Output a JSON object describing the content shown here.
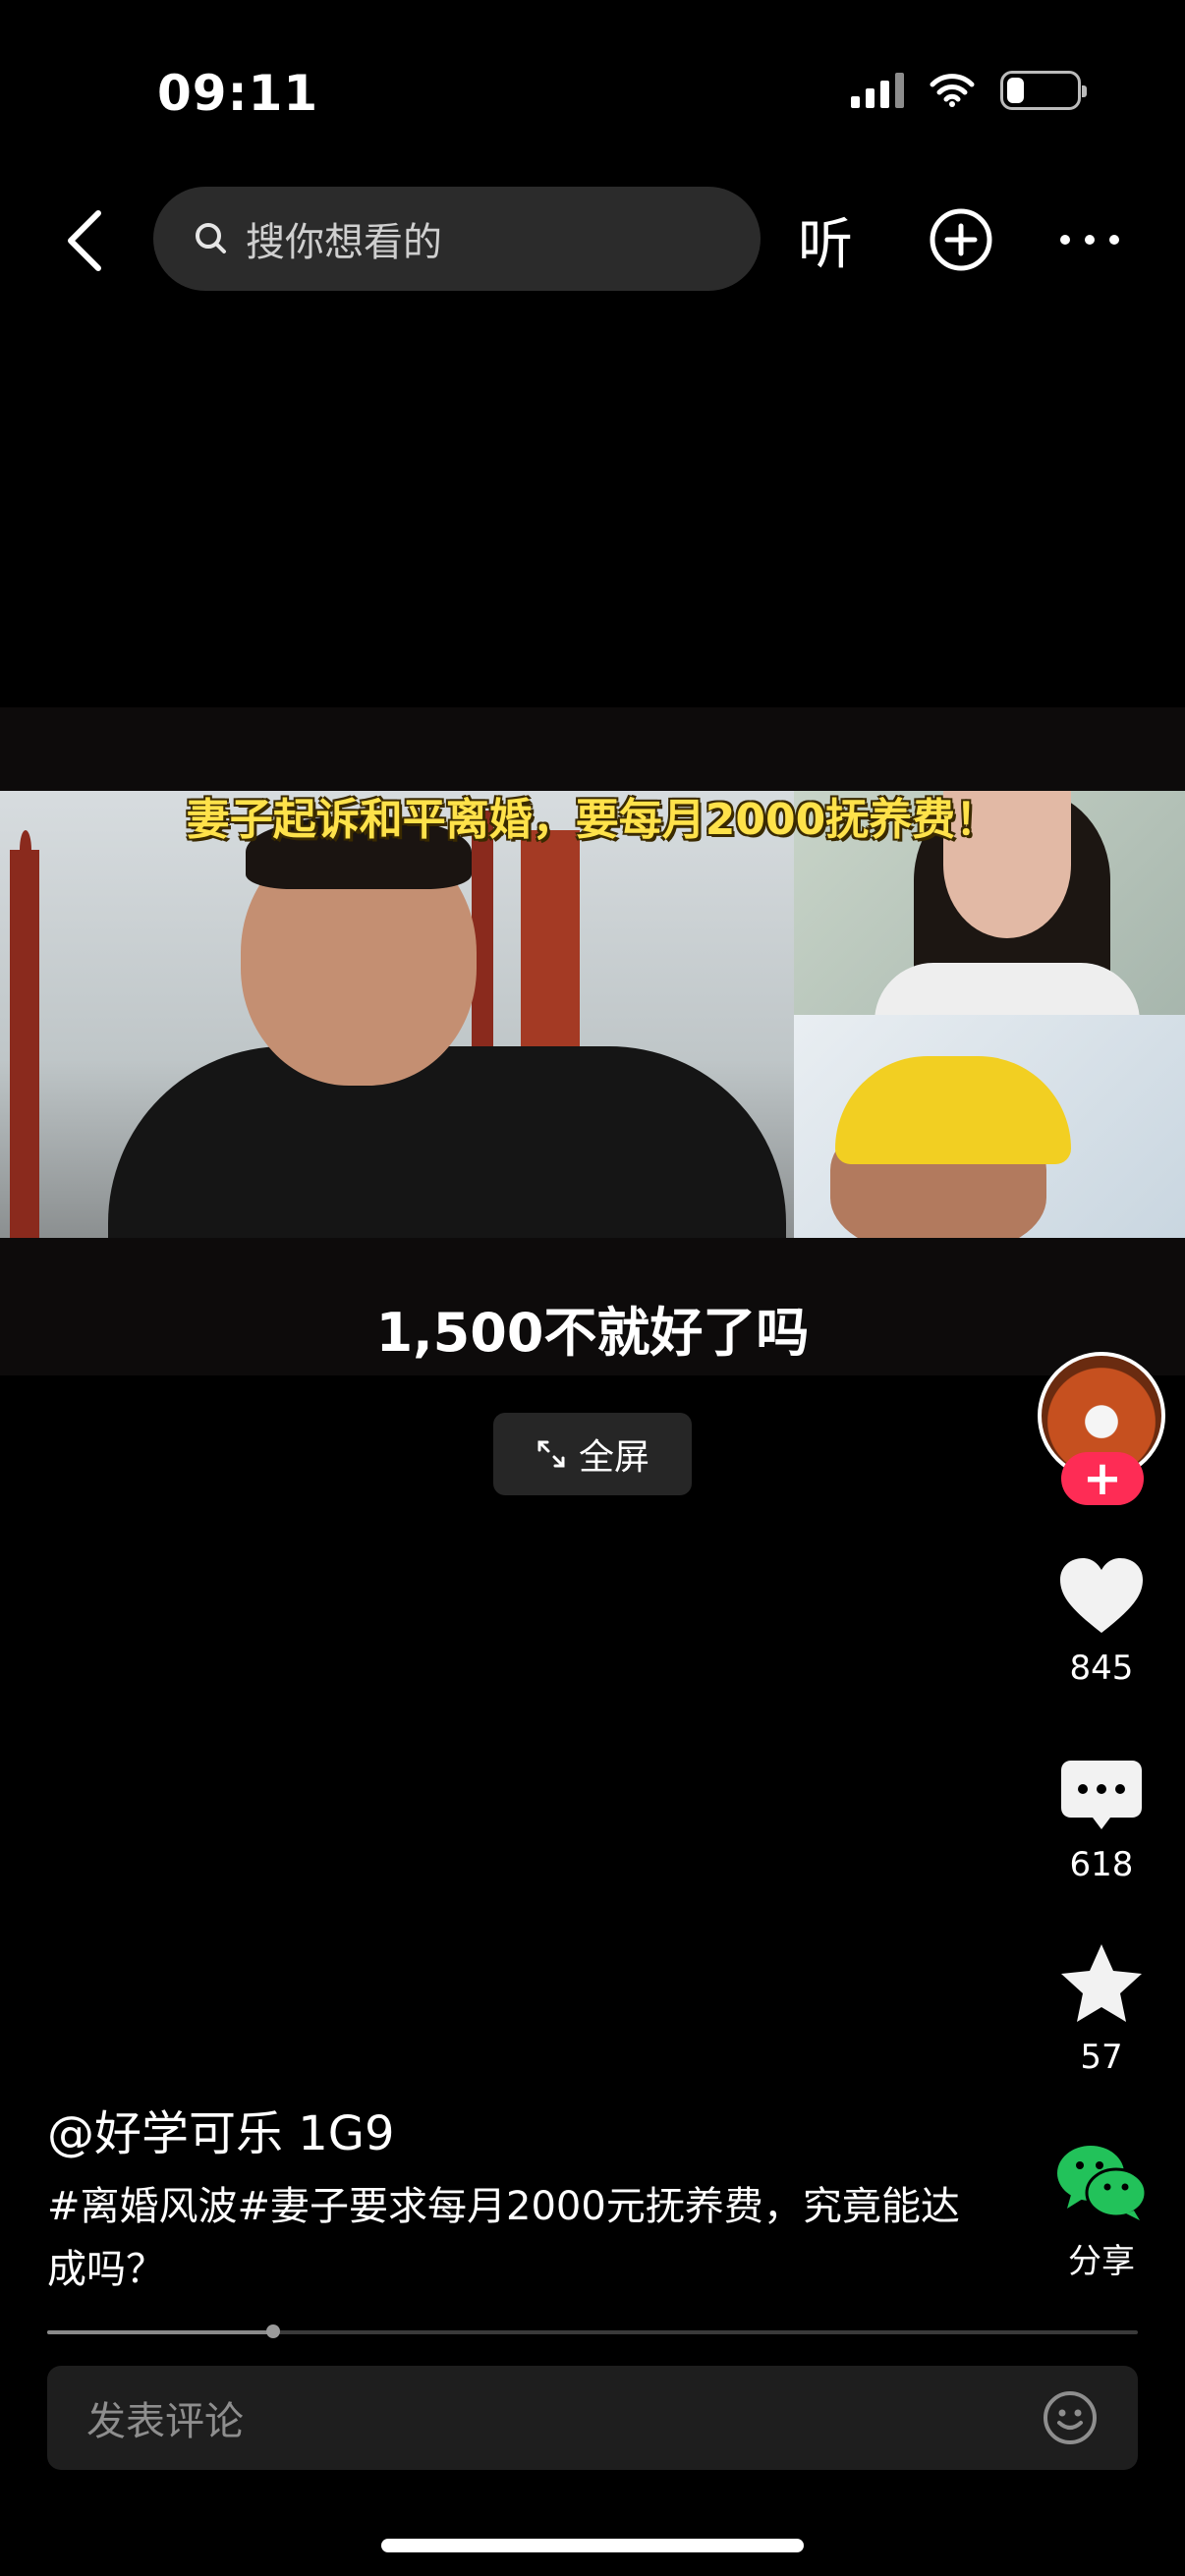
{
  "status_bar": {
    "time": "09:11",
    "battery_level": 0.25
  },
  "top_nav": {
    "back_icon": "chevron-left-icon",
    "search_placeholder": "搜你想看的",
    "listen_label": "听",
    "add_icon": "plus-circle-icon",
    "more_icon": "more-dots-icon"
  },
  "video": {
    "title_overlay": "妻子起诉和平离婚，要每月2000抚养费！",
    "subtitle": "1,500不就好了吗",
    "fullscreen_label": "全屏"
  },
  "actions": {
    "follow_label": "+",
    "like_count": "845",
    "comment_count": "618",
    "favorite_count": "57",
    "share_label": "分享"
  },
  "caption": {
    "author": "@好学可乐 1G9",
    "description": "#离婚风波#妻子要求每月2000元抚养费，究竟能达成吗？"
  },
  "playback": {
    "progress": 0.207
  },
  "comment": {
    "placeholder": "发表评论",
    "emoji_icon": "smiley-icon"
  },
  "colors": {
    "follow_accent": "#fe2c55",
    "share_green": "#22c25a",
    "title_yellow": "#ffe24a"
  }
}
